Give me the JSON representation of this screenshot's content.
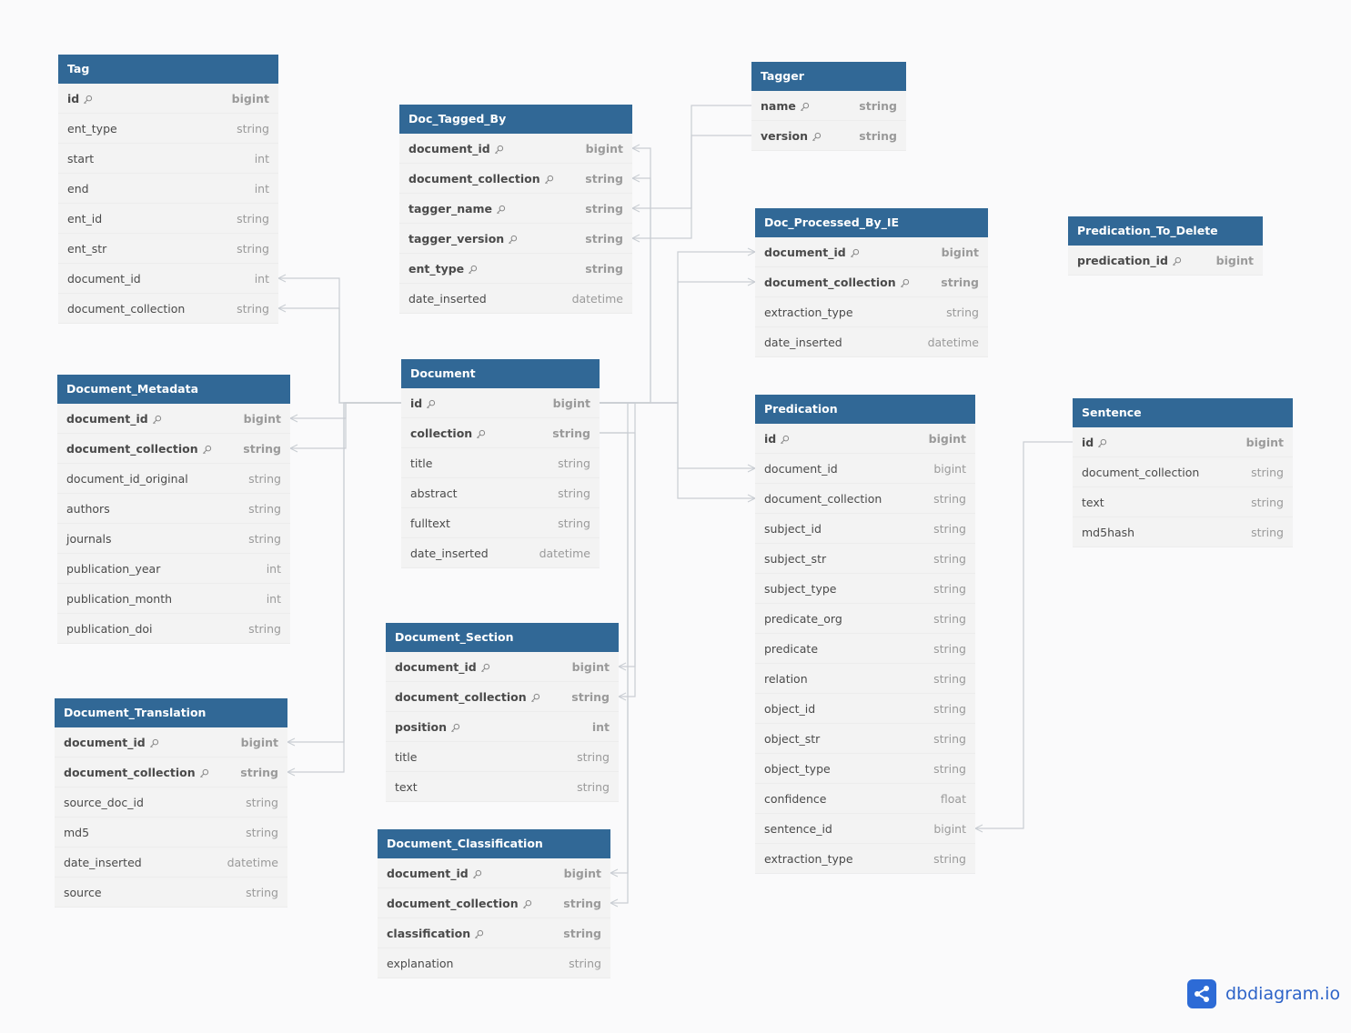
{
  "colors": {
    "header": "#316896",
    "row": "#f3f3f3",
    "link": "#c9cdd3",
    "brand": "#2d6bd6"
  },
  "brand": {
    "name": "dbdiagram.io",
    "icon": "share-nodes-icon"
  },
  "tables": [
    {
      "name": "Tag",
      "columns": [
        [
          "id",
          "bigint",
          true
        ],
        [
          "ent_type",
          "string",
          false
        ],
        [
          "start",
          "int",
          false
        ],
        [
          "end",
          "int",
          false
        ],
        [
          "ent_id",
          "string",
          false
        ],
        [
          "ent_str",
          "string",
          false
        ],
        [
          "document_id",
          "int",
          false
        ],
        [
          "document_collection",
          "string",
          false
        ]
      ]
    },
    {
      "name": "Doc_Tagged_By",
      "columns": [
        [
          "document_id",
          "bigint",
          true
        ],
        [
          "document_collection",
          "string",
          true
        ],
        [
          "tagger_name",
          "string",
          true
        ],
        [
          "tagger_version",
          "string",
          true
        ],
        [
          "ent_type",
          "string",
          true
        ],
        [
          "date_inserted",
          "datetime",
          false
        ]
      ]
    },
    {
      "name": "Tagger",
      "columns": [
        [
          "name",
          "string",
          true
        ],
        [
          "version",
          "string",
          true
        ]
      ]
    },
    {
      "name": "Doc_Processed_By_IE",
      "columns": [
        [
          "document_id",
          "bigint",
          true
        ],
        [
          "document_collection",
          "string",
          true
        ],
        [
          "extraction_type",
          "string",
          false
        ],
        [
          "date_inserted",
          "datetime",
          false
        ]
      ]
    },
    {
      "name": "Predication_To_Delete",
      "columns": [
        [
          "predication_id",
          "bigint",
          true
        ]
      ]
    },
    {
      "name": "Document_Metadata",
      "columns": [
        [
          "document_id",
          "bigint",
          true
        ],
        [
          "document_collection",
          "string",
          true
        ],
        [
          "document_id_original",
          "string",
          false
        ],
        [
          "authors",
          "string",
          false
        ],
        [
          "journals",
          "string",
          false
        ],
        [
          "publication_year",
          "int",
          false
        ],
        [
          "publication_month",
          "int",
          false
        ],
        [
          "publication_doi",
          "string",
          false
        ]
      ]
    },
    {
      "name": "Document",
      "columns": [
        [
          "id",
          "bigint",
          true
        ],
        [
          "collection",
          "string",
          true
        ],
        [
          "title",
          "string",
          false
        ],
        [
          "abstract",
          "string",
          false
        ],
        [
          "fulltext",
          "string",
          false
        ],
        [
          "date_inserted",
          "datetime",
          false
        ]
      ]
    },
    {
      "name": "Predication",
      "columns": [
        [
          "id",
          "bigint",
          true
        ],
        [
          "document_id",
          "bigint",
          false
        ],
        [
          "document_collection",
          "string",
          false
        ],
        [
          "subject_id",
          "string",
          false
        ],
        [
          "subject_str",
          "string",
          false
        ],
        [
          "subject_type",
          "string",
          false
        ],
        [
          "predicate_org",
          "string",
          false
        ],
        [
          "predicate",
          "string",
          false
        ],
        [
          "relation",
          "string",
          false
        ],
        [
          "object_id",
          "string",
          false
        ],
        [
          "object_str",
          "string",
          false
        ],
        [
          "object_type",
          "string",
          false
        ],
        [
          "confidence",
          "float",
          false
        ],
        [
          "sentence_id",
          "bigint",
          false
        ],
        [
          "extraction_type",
          "string",
          false
        ]
      ]
    },
    {
      "name": "Sentence",
      "columns": [
        [
          "id",
          "bigint",
          true
        ],
        [
          "document_collection",
          "string",
          false
        ],
        [
          "text",
          "string",
          false
        ],
        [
          "md5hash",
          "string",
          false
        ]
      ]
    },
    {
      "name": "Document_Section",
      "columns": [
        [
          "document_id",
          "bigint",
          true
        ],
        [
          "document_collection",
          "string",
          true
        ],
        [
          "position",
          "int",
          true
        ],
        [
          "title",
          "string",
          false
        ],
        [
          "text",
          "string",
          false
        ]
      ]
    },
    {
      "name": "Document_Translation",
      "columns": [
        [
          "document_id",
          "bigint",
          true
        ],
        [
          "document_collection",
          "string",
          true
        ],
        [
          "source_doc_id",
          "string",
          false
        ],
        [
          "md5",
          "string",
          false
        ],
        [
          "date_inserted",
          "datetime",
          false
        ],
        [
          "source",
          "string",
          false
        ]
      ]
    },
    {
      "name": "Document_Classification",
      "columns": [
        [
          "document_id",
          "bigint",
          true
        ],
        [
          "document_collection",
          "string",
          true
        ],
        [
          "classification",
          "string",
          true
        ],
        [
          "explanation",
          "string",
          false
        ]
      ]
    }
  ]
}
